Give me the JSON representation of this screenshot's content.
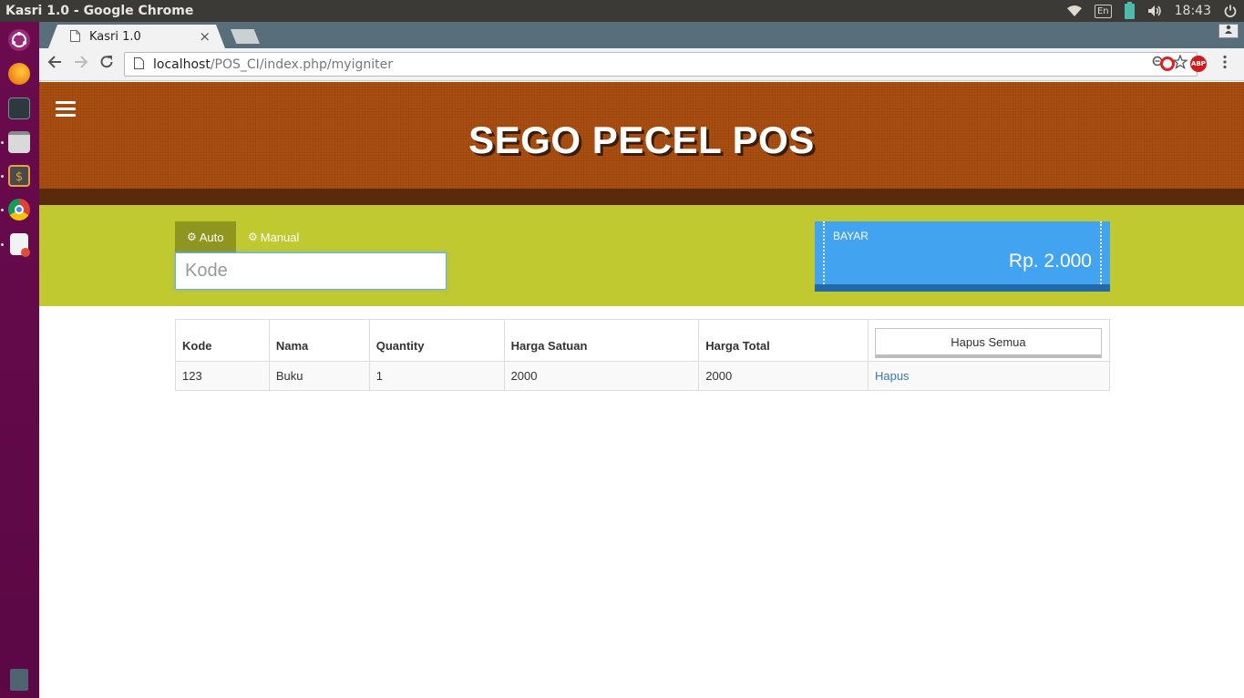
{
  "os": {
    "window_title": "Kasri 1.0 - Google Chrome",
    "keyboard_layout": "En",
    "clock": "18:43"
  },
  "browser": {
    "tab_title": "Kasri 1.0",
    "tab_close": "×",
    "url_host": "localhost",
    "url_path": "/POS_CI/index.php/myigniter",
    "abp_label": "ABP"
  },
  "app": {
    "title": "SEGO PECEL POS",
    "modes": {
      "auto": "Auto",
      "manual": "Manual"
    },
    "kode_placeholder": "Kode",
    "bayar": {
      "label": "BAYAR",
      "amount": "Rp. 2.000"
    },
    "table": {
      "headers": {
        "kode": "Kode",
        "nama": "Nama",
        "quantity": "Quantity",
        "harga_satuan": "Harga Satuan",
        "harga_total": "Harga Total"
      },
      "hapus_semua_label": "Hapus Semua",
      "rows": [
        {
          "kode": "123",
          "nama": "Buku",
          "quantity": "1",
          "harga_satuan": "2000",
          "harga_total": "2000",
          "action": "Hapus"
        }
      ]
    }
  },
  "colors": {
    "header_brown": "#ab4e11",
    "header_band": "#5a2a0c",
    "green_area": "#c0c930",
    "mode_active": "#8f9620",
    "bayar_blue": "#42a3f0",
    "launcher": "#6a0b4e"
  }
}
